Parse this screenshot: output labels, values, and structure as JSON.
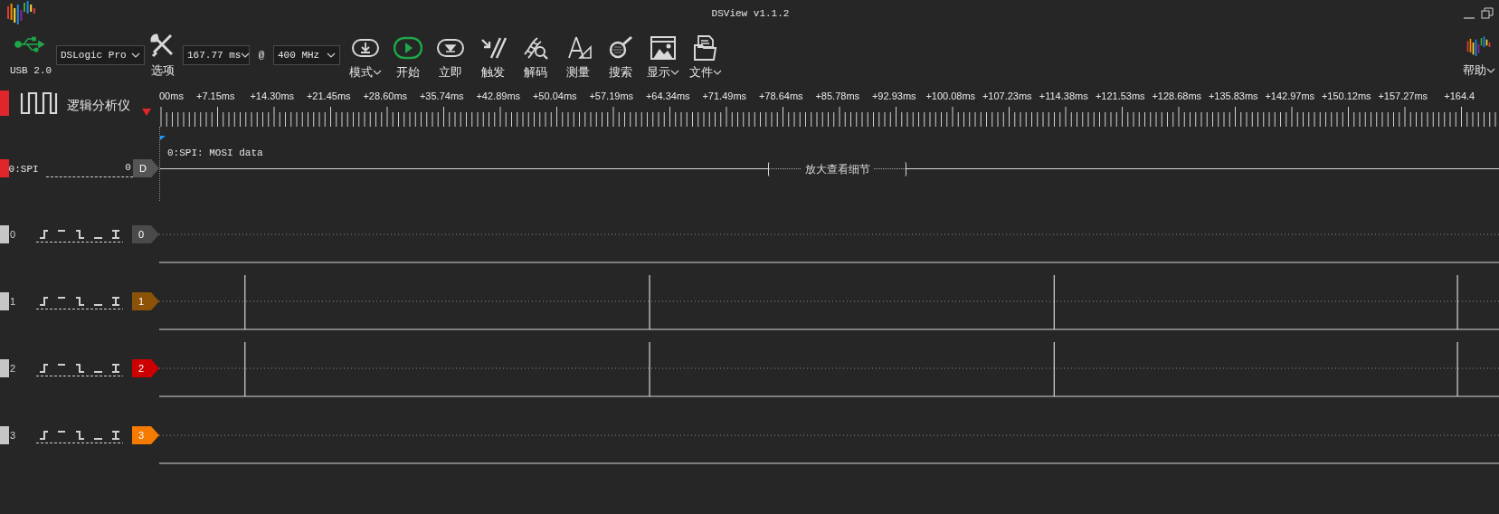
{
  "window": {
    "title": "DSView v1.1.2"
  },
  "toolbar": {
    "usb_label": "USB 2.0",
    "device": "DSLogic Pro",
    "options_label": "选项",
    "duration": "167.77 ms",
    "at": "@",
    "frequency": "400 MHz",
    "buttons": [
      {
        "kind": "mode",
        "label": "模式",
        "dropdown": true
      },
      {
        "kind": "start",
        "label": "开始",
        "dropdown": false
      },
      {
        "kind": "instant",
        "label": "立即",
        "dropdown": false
      },
      {
        "kind": "trigger",
        "label": "触发",
        "dropdown": false
      },
      {
        "kind": "decode",
        "label": "解码",
        "dropdown": false
      },
      {
        "kind": "measure",
        "label": "测量",
        "dropdown": false
      },
      {
        "kind": "search",
        "label": "搜索",
        "dropdown": false
      },
      {
        "kind": "display",
        "label": "显示",
        "dropdown": true
      },
      {
        "kind": "file",
        "label": "文件",
        "dropdown": true
      }
    ],
    "help": {
      "label": "帮助",
      "dropdown": true
    }
  },
  "header": {
    "title": "逻辑分析仪"
  },
  "ruler": {
    "labels": [
      "00ms",
      "+7.15ms",
      "+14.30ms",
      "+21.45ms",
      "+28.60ms",
      "+35.74ms",
      "+42.89ms",
      "+50.04ms",
      "+57.19ms",
      "+64.34ms",
      "+71.49ms",
      "+78.64ms",
      "+85.78ms",
      "+92.93ms",
      "+100.08ms",
      "+107.23ms",
      "+114.38ms",
      "+121.53ms",
      "+128.68ms",
      "+135.83ms",
      "+142.97ms",
      "+150.12ms",
      "+157.27ms",
      "+164.4"
    ]
  },
  "decoder": {
    "name": "0:SPI",
    "value": "0",
    "tag": "D",
    "color": "#e0262b",
    "annotation": "0:SPI: MOSI data",
    "hint": "放大查看细节"
  },
  "channels": [
    {
      "name": "0",
      "tag": "0",
      "color": "#4a4a4a",
      "kind": "idle"
    },
    {
      "name": "1",
      "tag": "1",
      "color": "#8b5208",
      "kind": "pulses"
    },
    {
      "name": "2",
      "tag": "2",
      "color": "#cc0000",
      "kind": "pulses"
    },
    {
      "name": "3",
      "tag": "3",
      "color": "#f57a00",
      "kind": "idle"
    }
  ]
}
